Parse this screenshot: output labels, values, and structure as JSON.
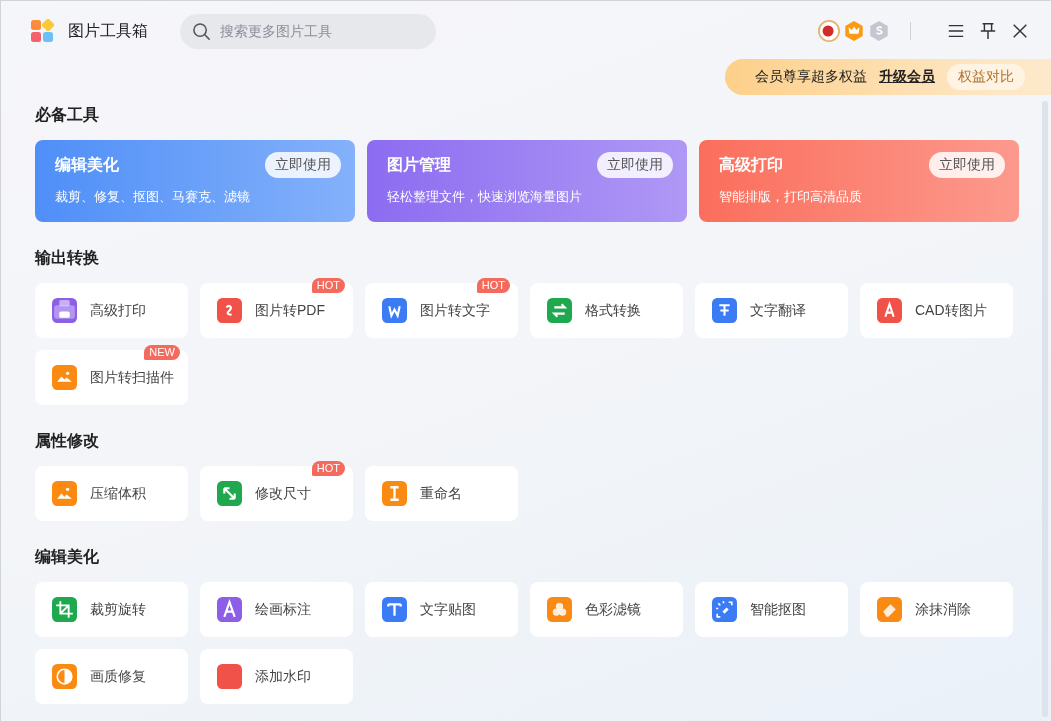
{
  "app": {
    "title": "图片工具箱"
  },
  "search": {
    "placeholder": "搜索更多图片工具"
  },
  "promo": {
    "text": "会员尊享超多权益",
    "link": "升级会员",
    "button": "权益对比"
  },
  "essentials": {
    "title": "必备工具",
    "features": [
      {
        "title": "编辑美化",
        "subtitle": "裁剪、修复、抠图、马赛克、滤镜",
        "button": "立即使用",
        "color": "#4f8ff8"
      },
      {
        "title": "图片管理",
        "subtitle": "轻松整理文件，快速浏览海量图片",
        "button": "立即使用",
        "color": "#8c6cf1"
      },
      {
        "title": "高级打印",
        "subtitle": "智能排版，打印高清品质",
        "button": "立即使用",
        "color": "#fb6e5c"
      }
    ]
  },
  "tool_sections": [
    {
      "title": "输出转换",
      "tools": [
        {
          "label": "高级打印",
          "color": "#8c5fe6"
        },
        {
          "label": "图片转PDF",
          "color": "#f0524a",
          "badge": "HOT"
        },
        {
          "label": "图片转文字",
          "color": "#3b7cf5",
          "badge": "HOT"
        },
        {
          "label": "格式转换",
          "color": "#20a84e"
        },
        {
          "label": "文字翻译",
          "color": "#3b7cf5"
        },
        {
          "label": "CAD转图片",
          "color": "#f0524a"
        },
        {
          "label": "图片转扫描件",
          "color": "#fb8a12",
          "badge": "NEW"
        }
      ]
    },
    {
      "title": "属性修改",
      "tools": [
        {
          "label": "压缩体积",
          "color": "#fb8a12"
        },
        {
          "label": "修改尺寸",
          "color": "#20a84e",
          "badge": "HOT"
        },
        {
          "label": "重命名",
          "color": "#fb8a12"
        }
      ]
    },
    {
      "title": "编辑美化",
      "tools": [
        {
          "label": "裁剪旋转",
          "color": "#20a84e"
        },
        {
          "label": "绘画标注",
          "color": "#8c5fe6"
        },
        {
          "label": "文字贴图",
          "color": "#3b7cf5"
        },
        {
          "label": "色彩滤镜",
          "color": "#fb8a12"
        },
        {
          "label": "智能抠图",
          "color": "#3b7cf5"
        },
        {
          "label": "涂抹消除",
          "color": "#fb8a12"
        },
        {
          "label": "画质修复",
          "color": "#fb8a12"
        },
        {
          "label": "添加水印",
          "color": "#f0524a"
        }
      ]
    }
  ]
}
